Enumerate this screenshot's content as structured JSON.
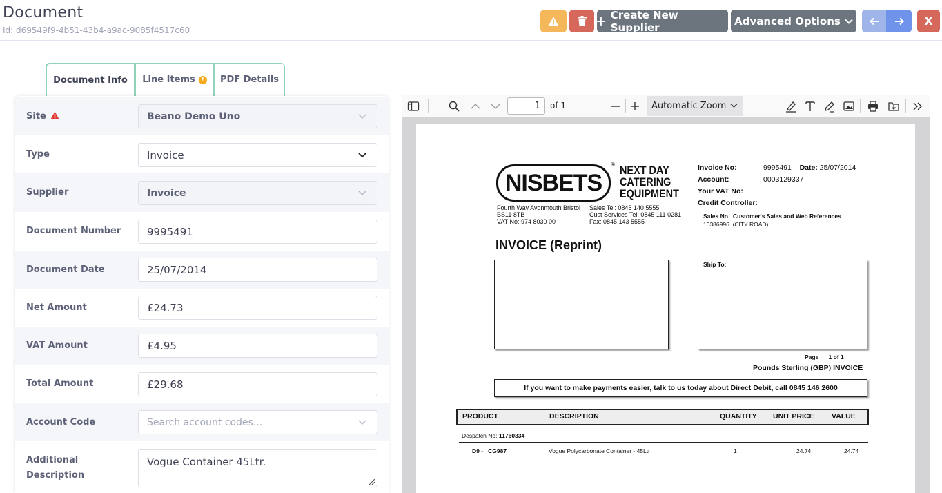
{
  "header": {
    "title": "Document",
    "id_text": "Id: d69549f9-4b51-43b4-a9ac-9085f4517c60",
    "create_supplier_label": "Create New Supplier",
    "advanced_options_label": "Advanced Options",
    "close_label": "X"
  },
  "tabs": [
    {
      "label": "Document Info",
      "active": true
    },
    {
      "label": "Line Items",
      "warning": true
    },
    {
      "label": "PDF Details"
    }
  ],
  "form": {
    "site": {
      "label": "Site",
      "value": "Beano Demo Uno"
    },
    "type": {
      "label": "Type",
      "value": "Invoice"
    },
    "supplier": {
      "label": "Supplier",
      "value": "Invoice"
    },
    "document_number": {
      "label": "Document Number",
      "value": "9995491"
    },
    "document_date": {
      "label": "Document Date",
      "value": "25/07/2014"
    },
    "net_amount": {
      "label": "Net Amount",
      "value": "£24.73"
    },
    "vat_amount": {
      "label": "VAT Amount",
      "value": "£4.95"
    },
    "total_amount": {
      "label": "Total Amount",
      "value": "£29.68"
    },
    "account_code": {
      "label": "Account Code",
      "placeholder": "Search account codes..."
    },
    "additional_description": {
      "label_line1": "Additional",
      "label_line2": "Description",
      "value": "Vogue Container 45Ltr."
    }
  },
  "viewer": {
    "page_number": "1",
    "page_total": "of 1",
    "zoom": "Automatic Zoom"
  },
  "invoice": {
    "logo": "NISBETS",
    "tagline_1": "NEXT DAY",
    "tagline_2": "CATERING",
    "tagline_3": "EQUIPMENT",
    "addr_1": "Fourth Way Avonmouth Bristol",
    "addr_2": "BS11 8TB",
    "addr_3": "VAT No: 974 8030 00",
    "tel_1": "Sales Tel: 0845 140 5555",
    "tel_2": "Cust Services Tel: 0845 111 0281",
    "tel_3": "Fax: 0845 143 5555",
    "invoice_no_label": "Invoice No:",
    "invoice_no": "9995491",
    "date_label": "Date:",
    "date": "25/07/2014",
    "account_label": "Account:",
    "account": "0003129337",
    "your_vat_label": "Your VAT No:",
    "credit_label": "Credit Controller:",
    "sales_no_label": "Sales No",
    "cust_refs_label": "Customer's Sales and Web References",
    "sales_no": "10386996",
    "city_road": "(CITY ROAD)",
    "heading": "INVOICE (Reprint)",
    "ship_to": "Ship To:",
    "page_label": "Page",
    "page_of": "1   of   1",
    "currency": "Pounds Sterling (GBP) INVOICE",
    "direct_debit": "If you want to make payments easier, talk to us today about Direct Debit, call 0845 146 2600",
    "col_product": "PRODUCT",
    "col_description": "DESCRIPTION",
    "col_quantity": "QUANTITY",
    "col_unit_price": "UNIT PRICE",
    "col_value": "VALUE",
    "despatch_label": "Despatch No:",
    "despatch_no": "11760334",
    "line_code_1": "D9  -",
    "line_code_2": "CG987",
    "line_desc": "Vogue Polycarbonate Container - 45Ltr",
    "line_qty": "1",
    "line_price": "24.74",
    "line_value": "24.74"
  },
  "colors": {
    "warning": "#f4b85a",
    "danger": "#d6685b",
    "secondary": "#6c757d",
    "primary": "#6f93ea",
    "tab_border": "#8fd3b9"
  }
}
